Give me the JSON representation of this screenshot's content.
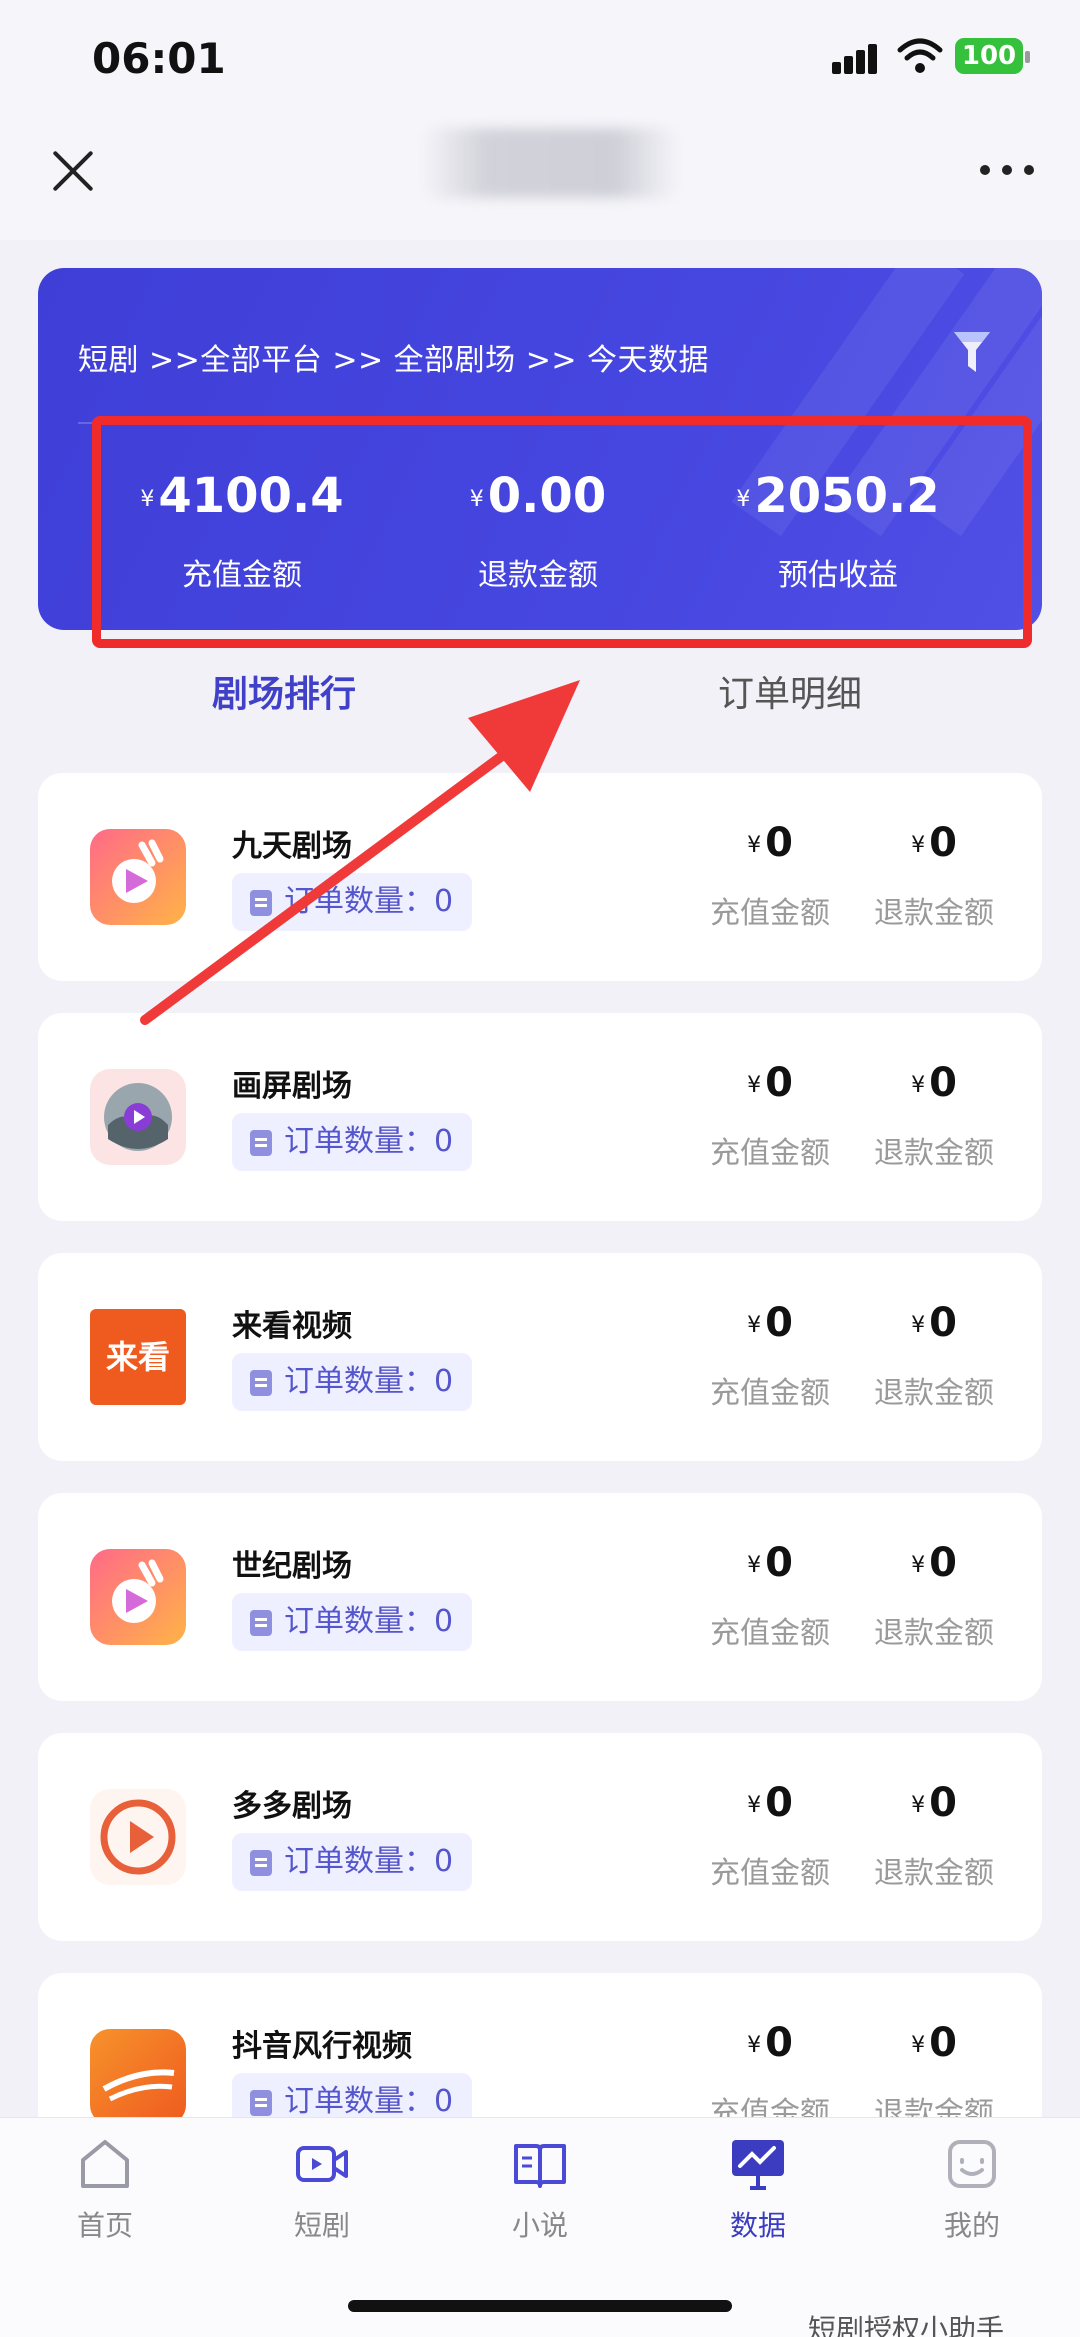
{
  "status": {
    "time": "06:01",
    "battery": "100"
  },
  "banner": {
    "breadcrumb": "短剧 >>全部平台 >> 全部剧场 >> 今天数据",
    "stats": [
      {
        "yen": "¥",
        "value": "4100.4",
        "label": "充值金额"
      },
      {
        "yen": "¥",
        "value": "0.00",
        "label": "退款金额"
      },
      {
        "yen": "¥",
        "value": "2050.2",
        "label": "预估收益"
      }
    ]
  },
  "tabs": {
    "active": "剧场排行",
    "inactive": "订单明细"
  },
  "theaters": [
    {
      "name": "九天剧场",
      "chip": "订单数量：0",
      "recharge": "0",
      "refund": "0",
      "recharge_label": "充值金额",
      "refund_label": "退款金额",
      "logo": "jiutian-logo-icon"
    },
    {
      "name": "画屏剧场",
      "chip": "订单数量：0",
      "recharge": "0",
      "refund": "0",
      "recharge_label": "充值金额",
      "refund_label": "退款金额",
      "logo": "huaping-logo-icon"
    },
    {
      "name": "来看视频",
      "chip": "订单数量：0",
      "recharge": "0",
      "refund": "0",
      "recharge_label": "充值金额",
      "refund_label": "退款金额",
      "logo": "laikan-logo-icon",
      "logo_text": "来看"
    },
    {
      "name": "世纪剧场",
      "chip": "订单数量：0",
      "recharge": "0",
      "refund": "0",
      "recharge_label": "充值金额",
      "refund_label": "退款金额",
      "logo": "shiji-logo-icon"
    },
    {
      "name": "多多剧场",
      "chip": "订单数量：0",
      "recharge": "0",
      "refund": "0",
      "recharge_label": "充值金额",
      "refund_label": "退款金额",
      "logo": "duoduo-logo-icon"
    },
    {
      "name": "抖音风行视频",
      "chip": "订单数量：0",
      "recharge": "0",
      "refund": "0",
      "recharge_label": "充值金额",
      "refund_label": "退款金额",
      "logo": "fengxing-logo-icon"
    }
  ],
  "tabbar": [
    {
      "label": "首页",
      "icon": "home-icon"
    },
    {
      "label": "短剧",
      "icon": "video-camera-icon"
    },
    {
      "label": "小说",
      "icon": "book-icon"
    },
    {
      "label": "数据",
      "icon": "chart-board-icon",
      "active": true
    },
    {
      "label": "我的",
      "icon": "profile-face-icon"
    }
  ],
  "watermark": "短剧授权小助手",
  "colors": {
    "accent": "#4343dc",
    "highlight_box": "#f02b2b",
    "arrow": "#f03a3a"
  }
}
